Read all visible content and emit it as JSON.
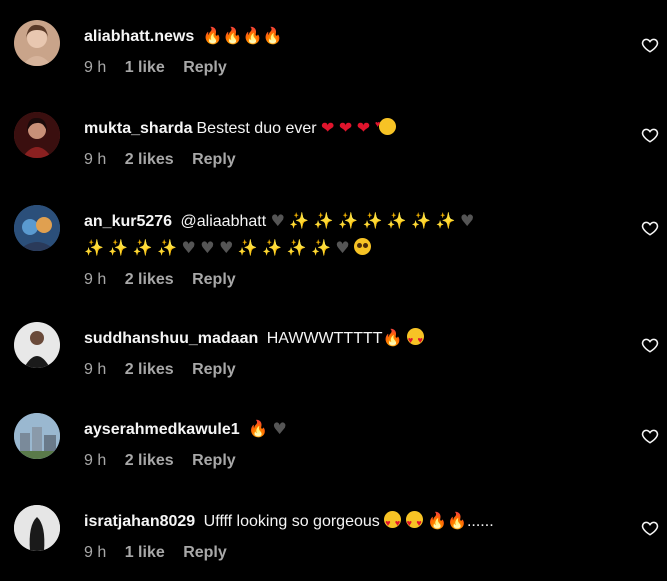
{
  "comments": [
    {
      "username": "aliabhatt.news",
      "text": "",
      "emojis": [
        "fire",
        "fire",
        "fire",
        "fire"
      ],
      "time": "9 h",
      "likes": "1 like",
      "reply": "Reply",
      "avatar_color": "#c9a48a"
    },
    {
      "username": "mukta_sharda",
      "text": "Bestest duo ever",
      "emojis": [
        "red-heart",
        "red-heart",
        "red-heart",
        "smiling-face-with-hearts"
      ],
      "time": "9 h",
      "likes": "2 likes",
      "reply": "Reply",
      "avatar_color": "#7a2a2a"
    },
    {
      "username": "an_kur5276",
      "text": "@aliaabhatt",
      "emojis_line1": [
        "black-heart",
        "sparkles",
        "sparkles",
        "sparkles",
        "sparkles",
        "sparkles",
        "sparkles",
        "sparkles",
        "black-heart"
      ],
      "emojis_line2": [
        "sparkles",
        "sparkles",
        "sparkles",
        "sparkles",
        "black-heart",
        "black-heart",
        "black-heart",
        "sparkles",
        "sparkles",
        "sparkles",
        "sparkles",
        "black-heart",
        "pleading-face"
      ],
      "time": "9 h",
      "likes": "2 likes",
      "reply": "Reply",
      "avatar_color": "#3a6a9a"
    },
    {
      "username": "suddhanshuu_madaan",
      "text": "HAWWWTTTTT",
      "emojis": [
        "fire",
        "smiling-face-with-heart-eyes"
      ],
      "time": "9 h",
      "likes": "2 likes",
      "reply": "Reply",
      "avatar_color": "#2a2a2a"
    },
    {
      "username": "ayserahmedkawule1",
      "text": "",
      "emojis": [
        "fire",
        "black-heart"
      ],
      "time": "9 h",
      "likes": "2 likes",
      "reply": "Reply",
      "avatar_color": "#6a8aa0"
    },
    {
      "username": "isratjahan8029",
      "text": "Uffff looking so gorgeous",
      "emojis": [
        "smiling-face-with-heart-eyes",
        "smiling-face-with-heart-eyes",
        "fire",
        "fire"
      ],
      "trailing_text": "......",
      "time": "9 h",
      "likes": "1 like",
      "reply": "Reply",
      "avatar_color": "#d8d8d8"
    }
  ],
  "icons": {
    "like": "heart-outline-icon"
  }
}
